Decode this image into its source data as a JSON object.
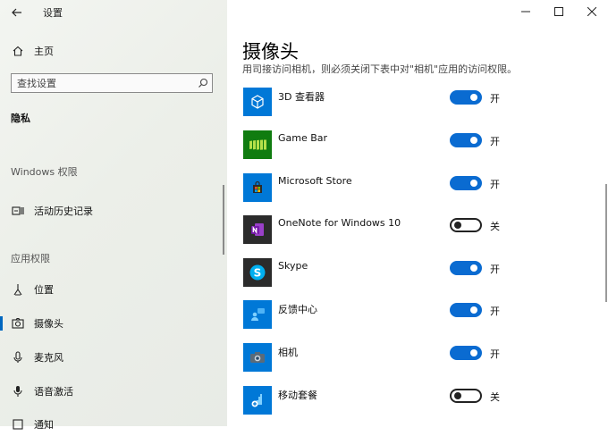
{
  "window": {
    "title": "设置"
  },
  "sidebar": {
    "home_label": "主页",
    "search_placeholder": "查找设置",
    "category_title": "隐私",
    "section_windows": "Windows 权限",
    "activity_history": "活动历史记录",
    "section_app": "应用权限",
    "items": [
      {
        "label": "位置",
        "icon": "location-icon"
      },
      {
        "label": "摄像头",
        "icon": "camera-icon",
        "active": true
      },
      {
        "label": "麦克风",
        "icon": "microphone-icon"
      },
      {
        "label": "语音激活",
        "icon": "voice-activation-icon"
      },
      {
        "label": "通知",
        "icon": "notification-icon"
      }
    ]
  },
  "main": {
    "title": "摄像头",
    "cut_text": "用司接访问相机，则必须关闭下表中对\"相机\"应用的访问权限。",
    "apps": [
      {
        "name": "3D 查看器",
        "state": "开",
        "on": true,
        "icon": "3d-viewer-icon",
        "color": "#0078d7"
      },
      {
        "name": "Game Bar",
        "state": "开",
        "on": true,
        "icon": "game-bar-icon",
        "color": "#107c10"
      },
      {
        "name": "Microsoft Store",
        "state": "开",
        "on": true,
        "icon": "store-icon",
        "color": "#0078d7"
      },
      {
        "name": "OneNote for Windows 10",
        "state": "关",
        "on": false,
        "icon": "onenote-icon",
        "color": "#7719aa"
      },
      {
        "name": "Skype",
        "state": "开",
        "on": true,
        "icon": "skype-icon",
        "color": "#00aff0"
      },
      {
        "name": "反馈中心",
        "state": "开",
        "on": true,
        "icon": "feedback-hub-icon",
        "color": "#0078d7"
      },
      {
        "name": "相机",
        "state": "开",
        "on": true,
        "icon": "camera-app-icon",
        "color": "#0078d7"
      },
      {
        "name": "移动套餐",
        "state": "关",
        "on": false,
        "icon": "mobile-plans-icon",
        "color": "#0078d7"
      }
    ]
  },
  "colors": {
    "accent": "#0a6bd1"
  }
}
